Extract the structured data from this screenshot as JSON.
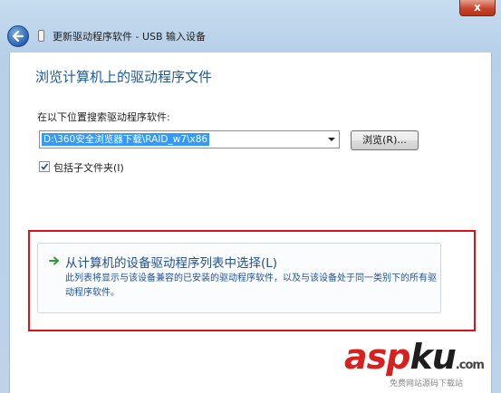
{
  "window": {
    "close_glyph": "x",
    "title": "更新驱动程序软件 - USB 输入设备"
  },
  "page": {
    "heading": "浏览计算机上的驱动程序文件",
    "search_label": "在以下位置搜索驱动程序软件:",
    "path_value": "D:\\360安全浏览器下载\\RAID_w7\\x86",
    "browse_button": "浏览(R)...",
    "include_subfolders": {
      "label": "包括子文件夹(I)",
      "checked": true
    }
  },
  "option": {
    "title": "从计算机的设备驱动程序列表中选择(L)",
    "description": "此列表将显示与该设备兼容的已安装的驱动程序软件，以及与该设备处于同一类别下的所有驱动程序软件。"
  },
  "watermark": {
    "brand_asp": "asp",
    "brand_ku": "ku",
    "brand_suffix": ".com",
    "tagline": "免费网站源码下载站"
  },
  "colors": {
    "accent_blue": "#1d5a96",
    "highlight_red": "#e0101a",
    "selection": "#3399ff"
  }
}
